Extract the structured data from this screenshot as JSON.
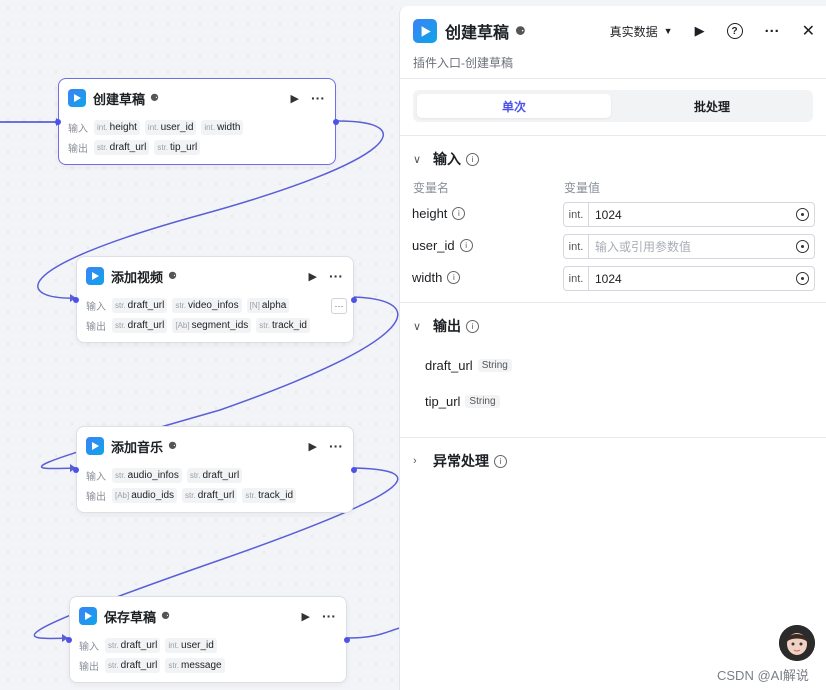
{
  "canvas": {
    "nodes": [
      {
        "title": "创建草稿",
        "input_label": "输入",
        "output_label": "输出",
        "inputs": [
          {
            "type": "int.",
            "name": "height"
          },
          {
            "type": "int.",
            "name": "user_id"
          },
          {
            "type": "int.",
            "name": "width"
          }
        ],
        "outputs": [
          {
            "type": "str.",
            "name": "draft_url"
          },
          {
            "type": "str.",
            "name": "tip_url"
          }
        ]
      },
      {
        "title": "添加视频",
        "input_label": "输入",
        "output_label": "输出",
        "inputs": [
          {
            "type": "str.",
            "name": "draft_url"
          },
          {
            "type": "str.",
            "name": "video_infos"
          },
          {
            "type": "[N]",
            "name": "alpha"
          }
        ],
        "outputs": [
          {
            "type": "str.",
            "name": "draft_url"
          },
          {
            "type": "[Ab]",
            "name": "segment_ids"
          },
          {
            "type": "str.",
            "name": "track_id"
          }
        ]
      },
      {
        "title": "添加音乐",
        "input_label": "输入",
        "output_label": "输出",
        "inputs": [
          {
            "type": "str.",
            "name": "audio_infos"
          },
          {
            "type": "str.",
            "name": "draft_url"
          }
        ],
        "outputs": [
          {
            "type": "[Ab]",
            "name": "audio_ids"
          },
          {
            "type": "str.",
            "name": "draft_url"
          },
          {
            "type": "str.",
            "name": "track_id"
          }
        ]
      },
      {
        "title": "保存草稿",
        "input_label": "输入",
        "output_label": "输出",
        "inputs": [
          {
            "type": "str.",
            "name": "draft_url"
          },
          {
            "type": "int.",
            "name": "user_id"
          }
        ],
        "outputs": [
          {
            "type": "str.",
            "name": "draft_url"
          },
          {
            "type": "str.",
            "name": "message"
          }
        ]
      }
    ]
  },
  "panel": {
    "title": "创建草稿",
    "data_select": "真实数据",
    "subtitle": "插件入口-创建草稿",
    "tabs": [
      "单次",
      "批处理"
    ],
    "input_section": {
      "title": "输入",
      "col_name": "变量名",
      "col_value": "变量值",
      "rows": [
        {
          "name": "height",
          "type": "int.",
          "value": "1024",
          "placeholder": ""
        },
        {
          "name": "user_id",
          "type": "int.",
          "value": "",
          "placeholder": "输入或引用参数值"
        },
        {
          "name": "width",
          "type": "int.",
          "value": "1024",
          "placeholder": ""
        }
      ]
    },
    "output_section": {
      "title": "输出",
      "rows": [
        {
          "name": "draft_url",
          "type": "String"
        },
        {
          "name": "tip_url",
          "type": "String"
        }
      ]
    },
    "error_section": {
      "title": "异常处理"
    }
  },
  "watermark": "CSDN @AI解说",
  "colors": {
    "accent": "#4d53e8",
    "edge": "#5b5fd6"
  }
}
